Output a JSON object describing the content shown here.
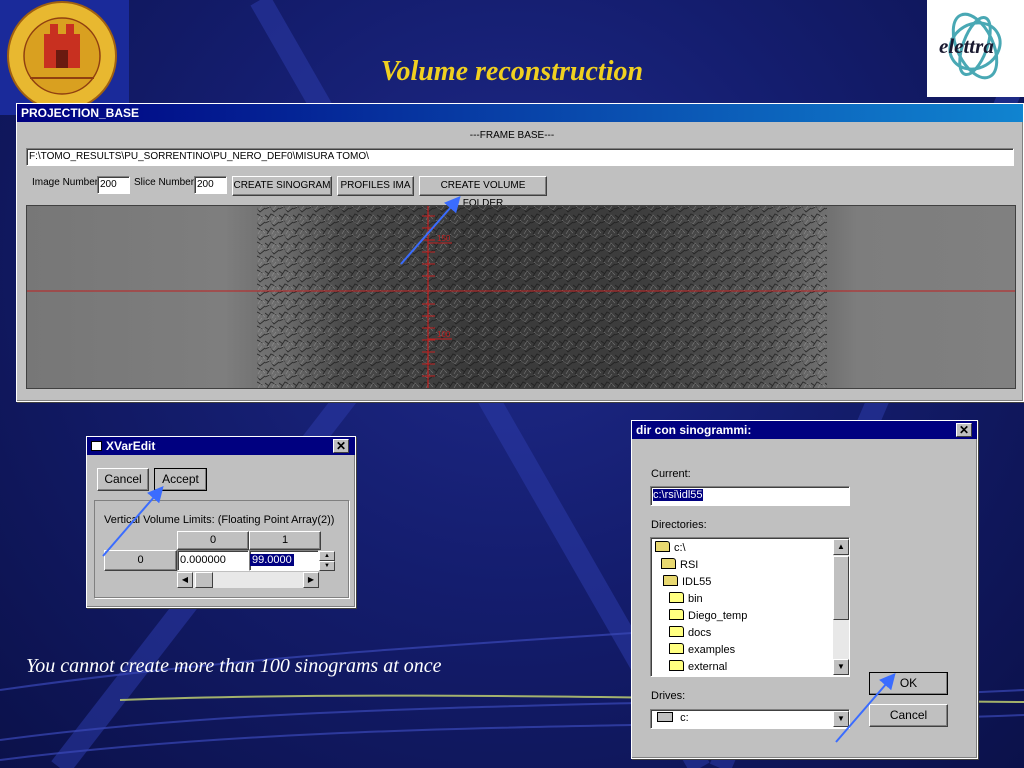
{
  "slide": {
    "title": "Volume reconstruction",
    "caption": "You cannot create more than 100 sinograms at once",
    "seal_text": "UNIVERSITÀ DEGLI STUDI DI TRIESTE",
    "brand_text": "elettra",
    "colors": {
      "title": "#f0d020",
      "background": "#141d6e",
      "arrow": "#3a6cff"
    }
  },
  "projection_window": {
    "title": "PROJECTION_BASE",
    "frame_label": "---FRAME BASE---",
    "path": "F:\\TOMO_RESULTS\\PU_SORRENTINO\\PU_NERO_DEF0\\MISURA TOMO\\",
    "image_number_label": "Image Number:",
    "image_number_value": "200",
    "slice_number_label": "Slice Number:",
    "slice_number_value": "200",
    "buttons": {
      "create_sinogram": "CREATE SINOGRAM",
      "profiles_ima": "PROFILES IMA",
      "create_volume_folder": "CREATE VOLUME FOLDER"
    },
    "ruler_labels": [
      "150",
      "100"
    ]
  },
  "xvaredit": {
    "title": "XVarEdit",
    "cancel": "Cancel",
    "accept": "Accept",
    "group_label": "Vertical Volume Limits: (Floating Point Array(2))",
    "col_headers": [
      "0",
      "1"
    ],
    "row_header": "0",
    "values": [
      "0.000000",
      "99.0000"
    ]
  },
  "dir_dialog": {
    "title": "dir con sinogrammi:",
    "current_label": "Current:",
    "current_value": "c:\\rsi\\idl55",
    "directories_label": "Directories:",
    "directories": [
      {
        "name": "c:\\",
        "open": true
      },
      {
        "name": "RSI",
        "open": true
      },
      {
        "name": "IDL55",
        "open": true
      },
      {
        "name": "bin",
        "open": false
      },
      {
        "name": "Diego_temp",
        "open": false
      },
      {
        "name": "docs",
        "open": false
      },
      {
        "name": "examples",
        "open": false
      },
      {
        "name": "external",
        "open": false
      }
    ],
    "drives_label": "Drives:",
    "drive_value": "c:",
    "ok": "OK",
    "cancel": "Cancel"
  }
}
